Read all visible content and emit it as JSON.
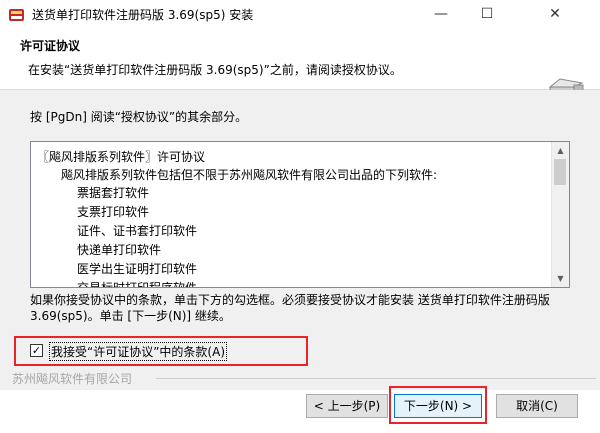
{
  "window": {
    "title": "送货单打印软件注册码版 3.69(sp5) 安装",
    "min_glyph": "—",
    "max_glyph": "☐",
    "close_glyph": "✕"
  },
  "header": {
    "title": "许可证协议",
    "subtitle": "在安装“送货单打印软件注册码版 3.69(sp5)”之前，请阅读授权协议。"
  },
  "instruction": "按 [PgDn] 阅读“授权协议”的其余部分。",
  "license_lines": [
    "〖飚风排版系列软件〗许可协议",
    "飚风排版系列软件包括但不限于苏州飚风软件有限公司出品的下列软件:",
    "票据套打软件",
    "支票打印软件",
    "证件、证书套打印软件",
    "快递单打印软件",
    "医学出生证明打印软件",
    "next_partial_line_hidden"
  ],
  "license_partial": "交易标时打印程序软件",
  "scroll": {
    "up_glyph": "▲",
    "down_glyph": "▼"
  },
  "note": "如果你接受协议中的条款，单击下方的勾选框。必须要接受协议才能安装 送货单打印软件注册码版 3.69(sp5)。单击 [下一步(N)] 继续。",
  "accept": {
    "checked_glyph": "✓",
    "label": "我接受“许可证协议”中的条款(A)"
  },
  "brand": "苏州飚风软件有限公司",
  "buttons": {
    "back": "< 上一步(P)",
    "next": "下一步(N) >",
    "cancel": "取消(C)"
  },
  "colors": {
    "highlight": "#e8232a",
    "focus_border": "#0078d7"
  }
}
